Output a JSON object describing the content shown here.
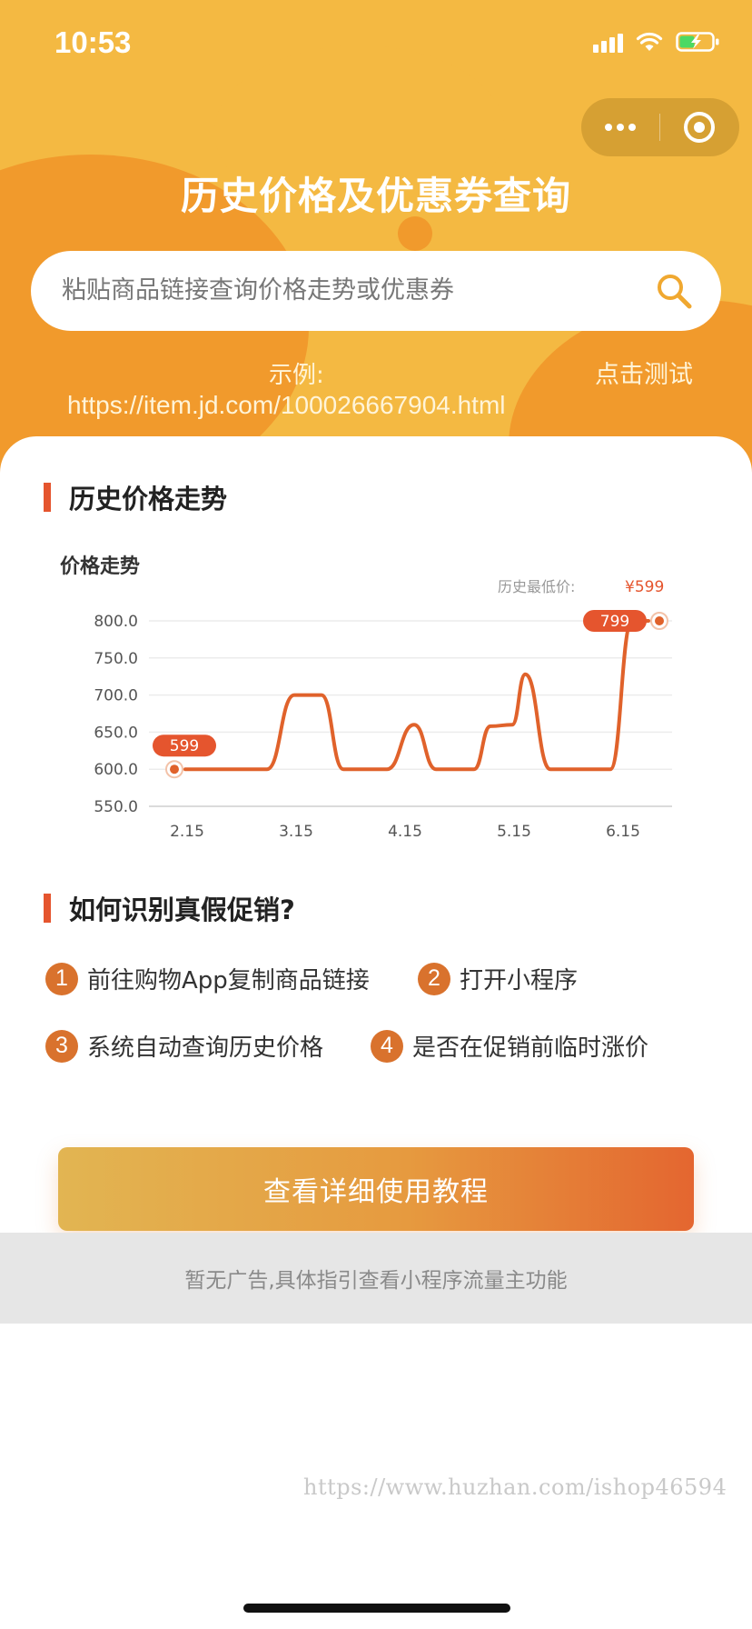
{
  "status": {
    "time": "10:53"
  },
  "header": {
    "title": "历史价格及优惠券查询"
  },
  "search": {
    "placeholder": "粘贴商品链接查询价格走势或优惠券"
  },
  "example": {
    "label": "示例:",
    "action": "点击测试",
    "url": "https://item.jd.com/100026667904.html"
  },
  "section_trend": {
    "title": "历史价格走势"
  },
  "chart_data": {
    "type": "line",
    "title": "价格走势",
    "annotation_label": "历史最低价:",
    "annotation_value": "¥599",
    "x_ticks": [
      "2.15",
      "3.15",
      "4.15",
      "5.15",
      "6.15"
    ],
    "y_ticks": [
      "800.0",
      "750.0",
      "700.0",
      "650.0",
      "600.0",
      "550.0"
    ],
    "ylim": [
      550,
      800
    ],
    "series": [
      {
        "points": [
          {
            "x": 0.0,
            "y": 600
          },
          {
            "x": 0.75,
            "y": 600
          },
          {
            "x": 1.0,
            "y": 700
          },
          {
            "x": 1.25,
            "y": 700
          },
          {
            "x": 1.45,
            "y": 600
          },
          {
            "x": 1.85,
            "y": 600
          },
          {
            "x": 2.1,
            "y": 660
          },
          {
            "x": 2.3,
            "y": 600
          },
          {
            "x": 2.65,
            "y": 600
          },
          {
            "x": 2.8,
            "y": 658
          },
          {
            "x": 3.0,
            "y": 660
          },
          {
            "x": 3.12,
            "y": 728
          },
          {
            "x": 3.35,
            "y": 600
          },
          {
            "x": 3.9,
            "y": 600
          },
          {
            "x": 4.1,
            "y": 800
          },
          {
            "x": 4.25,
            "y": 800
          }
        ],
        "min_label": "599",
        "max_label": "799"
      }
    ],
    "grid": true,
    "colors": {
      "line": "#e0622b",
      "badge": "#e5552e"
    }
  },
  "section_howto": {
    "title": "如何识别真假促销?"
  },
  "steps": [
    {
      "num": "1",
      "label": "前往购物App复制商品链接"
    },
    {
      "num": "2",
      "label": "打开小程序"
    },
    {
      "num": "3",
      "label": "系统自动查询历史价格"
    },
    {
      "num": "4",
      "label": "是否在促销前临时涨价"
    }
  ],
  "cta": {
    "label": "查看详细使用教程"
  },
  "ad": {
    "text": "暂无广告,具体指引查看小程序流量主功能"
  },
  "watermark": "https://www.huzhan.com/ishop46594"
}
